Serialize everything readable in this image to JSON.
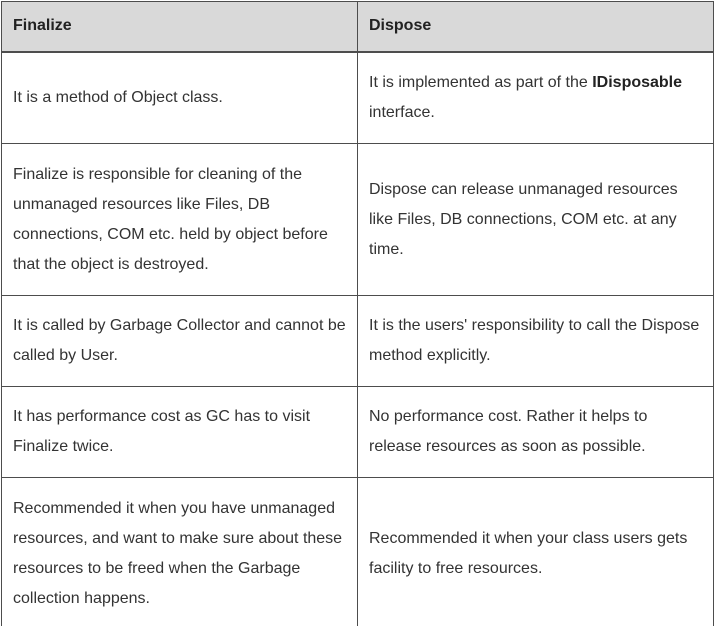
{
  "table": {
    "headers": [
      "Finalize",
      "Dispose"
    ],
    "rows": [
      {
        "finalize": "It is a method of Object class.",
        "dispose_before": "It is implemented as part of the ",
        "dispose_bold": "IDisposable",
        "dispose_after": " interface."
      },
      {
        "finalize": "Finalize is responsible for cleaning of the unmanaged resources like Files, DB connections, COM etc. held by object before that the object is destroyed.",
        "dispose": "Dispose can release unmanaged resources like Files, DB connections, COM etc. at any time."
      },
      {
        "finalize": "It is called by Garbage Collector and cannot be called by User.",
        "dispose": "It is the users' responsibility to call the Dispose method explicitly."
      },
      {
        "finalize": "It has performance cost as GC has to visit Finalize twice.",
        "dispose": "No performance cost. Rather it helps to release resources as soon as possible."
      },
      {
        "finalize": "Recommended it when you have unmanaged resources, and want to make sure about these resources to be freed when the Garbage collection happens.",
        "dispose": "Recommended it when your class users gets facility to free resources."
      }
    ]
  }
}
